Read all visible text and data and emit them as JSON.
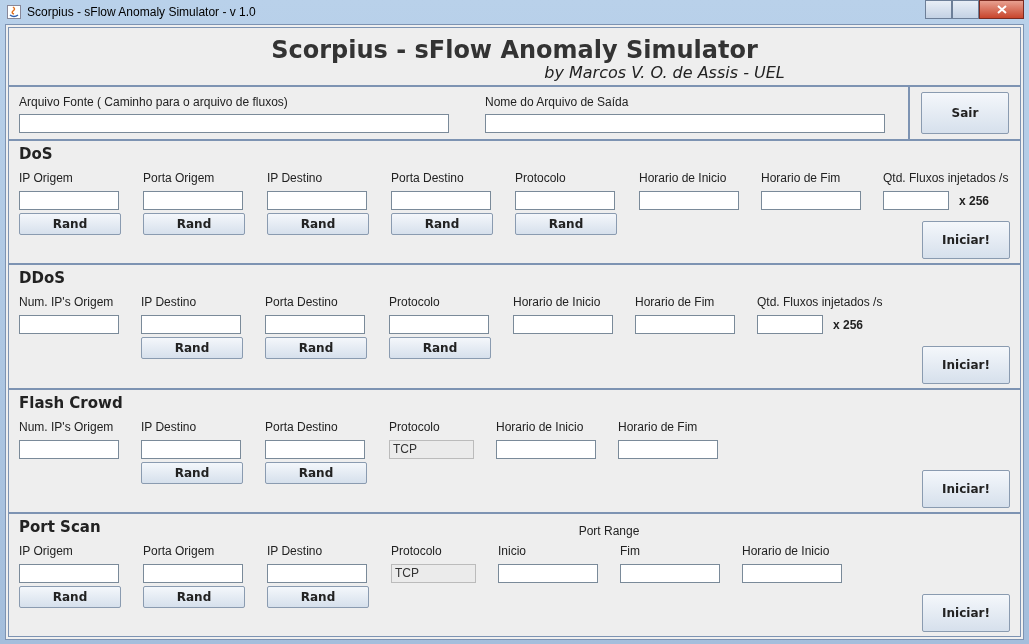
{
  "window": {
    "title": "Scorpius - sFlow Anomaly Simulator - v 1.0"
  },
  "header": {
    "title": "Scorpius - sFlow Anomaly Simulator",
    "subtitle": "by Marcos V. O. de Assis - UEL"
  },
  "files": {
    "fields": [
      {
        "label": "Arquivo Fonte ( Caminho para o arquivo de fluxos)"
      },
      {
        "label": "Nome do Arquivo de Saída"
      }
    ],
    "button": "Sair"
  },
  "sections": [
    {
      "title": "DoS",
      "button": "Iniciar!",
      "fields": [
        {
          "kind": "text",
          "label": "IP Origem",
          "rand": "Rand"
        },
        {
          "kind": "text",
          "label": "Porta Origem",
          "rand": "Rand"
        },
        {
          "kind": "text",
          "label": "IP Destino",
          "rand": "Rand"
        },
        {
          "kind": "text",
          "label": "Porta Destino",
          "rand": "Rand"
        },
        {
          "kind": "text",
          "label": "Protocolo",
          "rand": "Rand"
        },
        {
          "kind": "text",
          "label": "Horario de Inicio"
        },
        {
          "kind": "text",
          "label": "Horario de Fim"
        },
        {
          "kind": "text",
          "label": "Qtd. Fluxos injetados /s",
          "suffix": "x 256"
        }
      ]
    },
    {
      "title": "DDoS",
      "button": "Iniciar!",
      "fields": [
        {
          "kind": "text",
          "label": "Num. IP's Origem"
        },
        {
          "kind": "text",
          "label": "IP Destino",
          "rand": "Rand"
        },
        {
          "kind": "text",
          "label": "Porta Destino",
          "rand": "Rand"
        },
        {
          "kind": "text",
          "label": "Protocolo",
          "rand": "Rand"
        },
        {
          "kind": "text",
          "label": "Horario de Inicio"
        },
        {
          "kind": "text",
          "label": "Horario de Fim"
        },
        {
          "kind": "text",
          "label": "Qtd. Fluxos injetados /s",
          "suffix": "x 256"
        }
      ]
    },
    {
      "title": "Flash Crowd",
      "button": "Iniciar!",
      "fields": [
        {
          "kind": "text",
          "label": "Num. IP's Origem"
        },
        {
          "kind": "text",
          "label": "IP Destino",
          "rand": "Rand"
        },
        {
          "kind": "text",
          "label": "Porta Destino",
          "rand": "Rand"
        },
        {
          "kind": "readonly",
          "label": "Protocolo",
          "value": "TCP"
        },
        {
          "kind": "text",
          "label": "Horario de Inicio"
        },
        {
          "kind": "text",
          "label": "Horario de Fim"
        }
      ]
    },
    {
      "title": "Port Scan",
      "button": "Iniciar!",
      "fields": [
        {
          "kind": "text",
          "label": "IP Origem",
          "rand": "Rand"
        },
        {
          "kind": "text",
          "label": "Porta Origem",
          "rand": "Rand"
        },
        {
          "kind": "text",
          "label": "IP Destino",
          "rand": "Rand"
        },
        {
          "kind": "readonly",
          "label": "Protocolo",
          "value": "TCP"
        },
        {
          "kind": "group",
          "label": "Port Range",
          "fields": [
            {
              "kind": "text",
              "label": "Inicio"
            },
            {
              "kind": "text",
              "label": "Fim"
            }
          ]
        },
        {
          "kind": "text",
          "label": "Horario de Inicio"
        }
      ]
    }
  ]
}
